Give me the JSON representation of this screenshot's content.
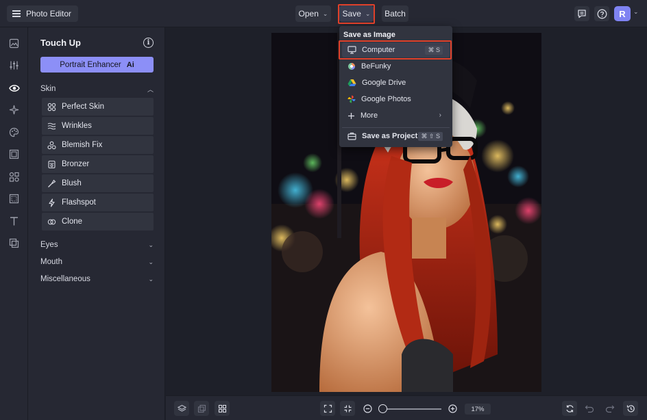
{
  "header": {
    "app_name": "Photo Editor",
    "open_label": "Open",
    "save_label": "Save",
    "batch_label": "Batch",
    "avatar_initial": "R"
  },
  "panel": {
    "title": "Touch Up",
    "enhancer_label": "Portrait Enhancer",
    "enhancer_badge": "Ai",
    "skin_label": "Skin",
    "skin_tools": [
      {
        "label": "Perfect Skin",
        "icon": "perfect-skin-icon"
      },
      {
        "label": "Wrinkles",
        "icon": "wrinkles-icon"
      },
      {
        "label": "Blemish Fix",
        "icon": "blemish-fix-icon"
      },
      {
        "label": "Bronzer",
        "icon": "bronzer-icon"
      },
      {
        "label": "Blush",
        "icon": "blush-brush-icon"
      },
      {
        "label": "Flashspot",
        "icon": "lightning-icon"
      },
      {
        "label": "Clone",
        "icon": "clone-icon"
      }
    ],
    "sections": [
      "Eyes",
      "Mouth",
      "Miscellaneous"
    ]
  },
  "dropdown": {
    "heading": "Save as Image",
    "items": [
      {
        "label": "Computer",
        "icon": "monitor-icon",
        "shortcut": "⌘ S"
      },
      {
        "label": "BeFunky",
        "icon": "befunky-logo-icon"
      },
      {
        "label": "Google Drive",
        "icon": "google-drive-icon"
      },
      {
        "label": "Google Photos",
        "icon": "google-photos-icon"
      },
      {
        "label": "More",
        "icon": "plus-icon"
      }
    ],
    "project_label": "Save as Project",
    "project_shortcut": "⌘ ⇧ S"
  },
  "bottombar": {
    "zoom_value": "17%"
  },
  "colors": {
    "accent": "#8c8ff7",
    "highlight": "#e0402a",
    "background": "#1e2029",
    "panel": "#262833"
  }
}
